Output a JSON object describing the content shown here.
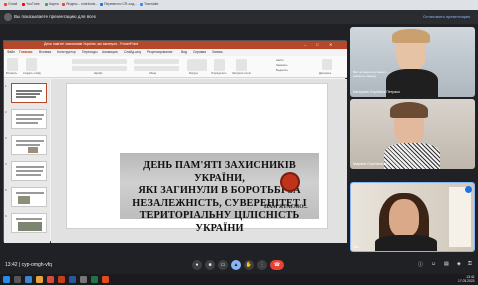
{
  "browser": {
    "bookmarks": [
      {
        "label": "Gmail",
        "color": "#ea4335"
      },
      {
        "label": "YouTube",
        "color": "#ff0000"
      },
      {
        "label": "Карты",
        "color": "#34a853"
      },
      {
        "label": "Яндекс - notebook...",
        "color": "#fc3f1d"
      },
      {
        "label": "Перевести CR-сод...",
        "color": "#1a73e8"
      },
      {
        "label": "Translate",
        "color": "#4285f4"
      }
    ]
  },
  "banner": {
    "text": "Вы показываете презентацию для всех",
    "button": "Остановить презентацию"
  },
  "powerpoint": {
    "title": "День пам'яті захисників України, які загинули - PowerPoint",
    "tabs": [
      "Файл",
      "Главная",
      "Вставка",
      "Конструктор",
      "Переходы",
      "Анимация",
      "Слайд-шоу",
      "Рецензирование",
      "Вид",
      "Справка",
      "Запись"
    ],
    "ribbon_labels": [
      "Вставить",
      "Создать слайд",
      "Шрифт",
      "Абзац",
      "Фигуры",
      "Упорядочить",
      "Экспресс-стили",
      "Найти",
      "Заменить",
      "Выделить",
      "Диктовать"
    ],
    "slide_numbers": [
      "1",
      "2",
      "3",
      "4",
      "5",
      "6"
    ],
    "slide": {
      "title_lines": [
        "ДЕНЬ ПАМ'ЯТІ ЗАХИСНИКІВ УКРАЇНИ,",
        "ЯКІ ЗАГИНУЛИ В БОРОТЬБІ ЗА",
        "НЕЗАЛЕЖНІСТЬ, СУВЕРЕНІТЕТ І",
        "ТЕРИТОРІАЛЬНУ ЦІЛІСНІСТЬ УКРАЇНИ"
      ],
      "footer": "ПАМ'ЯТАЄМО..."
    }
  },
  "participants": [
    {
      "name": "Катерина Сергіївна Петрако",
      "note": "Вас не видно на камері — увімкніть камеру"
    },
    {
      "name": "Марина Сергіївна М..."
    },
    {
      "name": "Вы"
    }
  ],
  "meet": {
    "time_code": "13:42  |  cyp-omgh-vfq",
    "controls": [
      "mic-icon",
      "camera-icon",
      "captions-icon",
      "present-icon",
      "raise-hand-icon",
      "more-icon",
      "hang-up-icon"
    ]
  },
  "taskbar": {
    "time": "13:42",
    "date": "17.03.2023"
  }
}
